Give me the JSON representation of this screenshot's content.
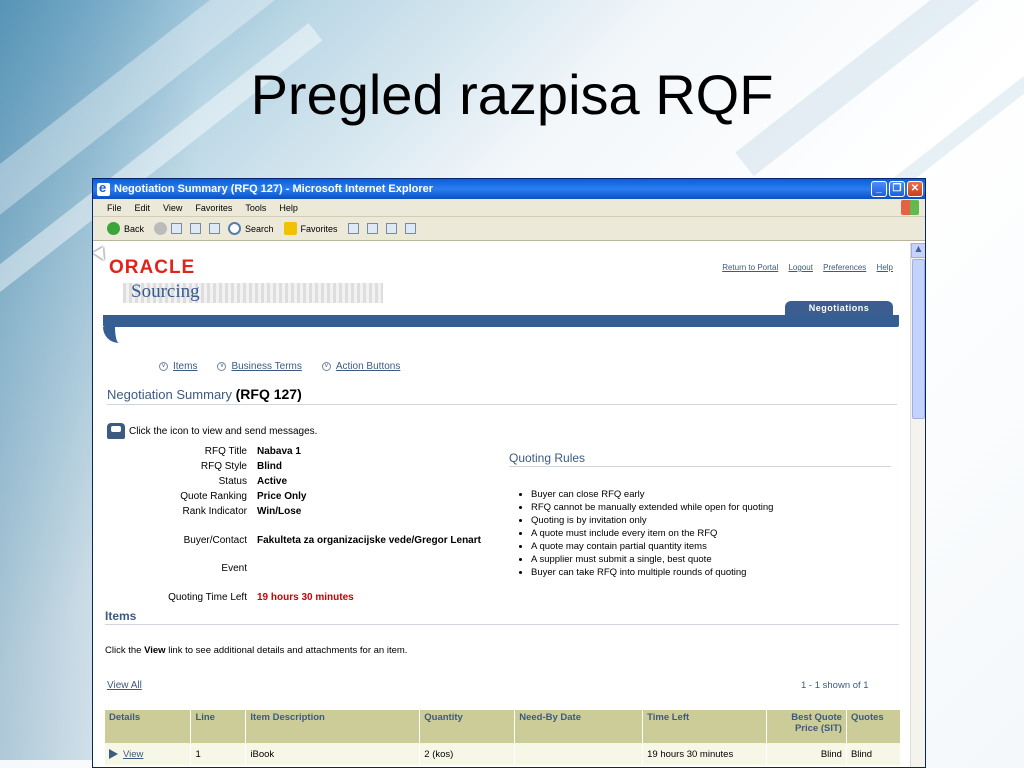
{
  "slide": {
    "title": "Pregled razpisa RQF"
  },
  "window": {
    "title": "Negotiation Summary (RFQ 127) - Microsoft Internet Explorer",
    "menu": [
      "File",
      "Edit",
      "View",
      "Favorites",
      "Tools",
      "Help"
    ],
    "toolbar": {
      "back": "Back",
      "search": "Search",
      "favorites": "Favorites"
    }
  },
  "header": {
    "logo": "ORACLE",
    "product": "Sourcing",
    "links": [
      "Return to Portal",
      "Logout",
      "Preferences",
      "Help"
    ],
    "tab": "Negotiations"
  },
  "subnav": [
    "Items",
    "Business Terms",
    "Action Buttons"
  ],
  "summary": {
    "heading": "Negotiation Summary",
    "rfq": "(RFQ 127)",
    "message": "Click the icon to view and send messages.",
    "fields": [
      {
        "label": "RFQ Title",
        "value": "Nabava 1"
      },
      {
        "label": "RFQ Style",
        "value": "Blind"
      },
      {
        "label": "Status",
        "value": "Active"
      },
      {
        "label": "Quote Ranking",
        "value": "Price Only"
      },
      {
        "label": "Rank Indicator",
        "value": "Win/Lose"
      },
      {
        "label": "Buyer/Contact",
        "value": "Fakulteta za organizacijske vede/Gregor Lenart"
      },
      {
        "label": "Event",
        "value": ""
      },
      {
        "label": "Quoting Time Left",
        "value": "19 hours 30 minutes"
      }
    ]
  },
  "quoting_rules": {
    "title": "Quoting Rules",
    "rules": [
      "Buyer can close RFQ early",
      "RFQ cannot be manually extended while open for quoting",
      "Quoting is by invitation only",
      "A quote must include every item on the RFQ",
      "A quote may contain partial quantity items",
      "A supplier must submit a single, best quote",
      "Buyer can take RFQ into multiple rounds of quoting"
    ]
  },
  "items": {
    "title": "Items",
    "help_pre": "Click the ",
    "help_bold": "View",
    "help_post": " link to see additional details and attachments for an item.",
    "view_all": "View All",
    "count": "1 - 1 shown of 1",
    "columns": [
      "Details",
      "Line",
      "Item Description",
      "Quantity",
      "Need-By Date",
      "Time Left",
      "Best Quote Price (SIT)",
      "Quotes"
    ],
    "rows": [
      {
        "details": "View",
        "line": "1",
        "description": "iBook",
        "quantity": "2  (kos)",
        "need_by": "",
        "time_left": "19 hours 30 minutes",
        "best_quote": "Blind",
        "quotes": "Blind"
      }
    ]
  },
  "colors": {
    "accent": "#3d5a80",
    "header_band": "#355e92",
    "table_header": "#cccc99",
    "alert": "#cc0000",
    "oracle_red": "#e2231a"
  }
}
